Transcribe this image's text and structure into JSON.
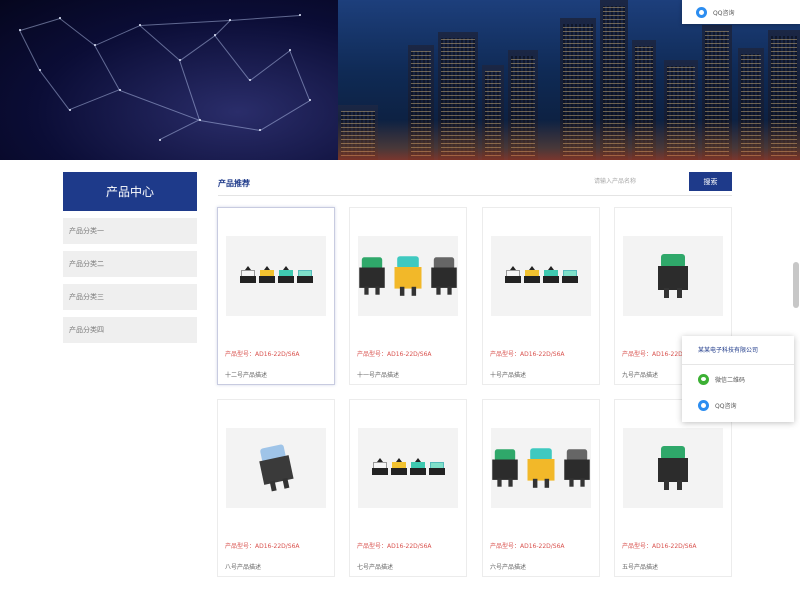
{
  "sidebar": {
    "title": "产品中心",
    "items": [
      {
        "label": "产品分类一"
      },
      {
        "label": "产品分类二"
      },
      {
        "label": "产品分类三"
      },
      {
        "label": "产品分类四"
      }
    ]
  },
  "section": {
    "title": "产品推荐",
    "search_placeholder": "请输入产品名称",
    "search_button": "搜索"
  },
  "products": [
    {
      "model": "产品型号：AD16-22D/S6A",
      "name": "十二号产品描述"
    },
    {
      "model": "产品型号：AD16-22D/S6A",
      "name": "十一号产品描述"
    },
    {
      "model": "产品型号：AD16-22D/S6A",
      "name": "十号产品描述"
    },
    {
      "model": "产品型号：AD16-22D/S6A",
      "name": "九号产品描述"
    },
    {
      "model": "产品型号：AD16-22D/S6A",
      "name": "八号产品描述"
    },
    {
      "model": "产品型号：AD16-22D/S6A",
      "name": "七号产品描述"
    },
    {
      "model": "产品型号：AD16-22D/S6A",
      "name": "六号产品描述"
    },
    {
      "model": "产品型号：AD16-22D/S6A",
      "name": "五号产品描述"
    }
  ],
  "contact_widget": {
    "company": "某某电子科技有限公司",
    "wechat_label": "微信二维码",
    "qq_label": "QQ咨询"
  },
  "top_widget": {
    "qq_label": "QQ咨询"
  },
  "colors": {
    "brand": "#1e3a8a",
    "price_red": "#d9534f",
    "sidebar_item_bg": "#efefef"
  },
  "icons": [
    "qq-icon",
    "wechat-icon"
  ]
}
